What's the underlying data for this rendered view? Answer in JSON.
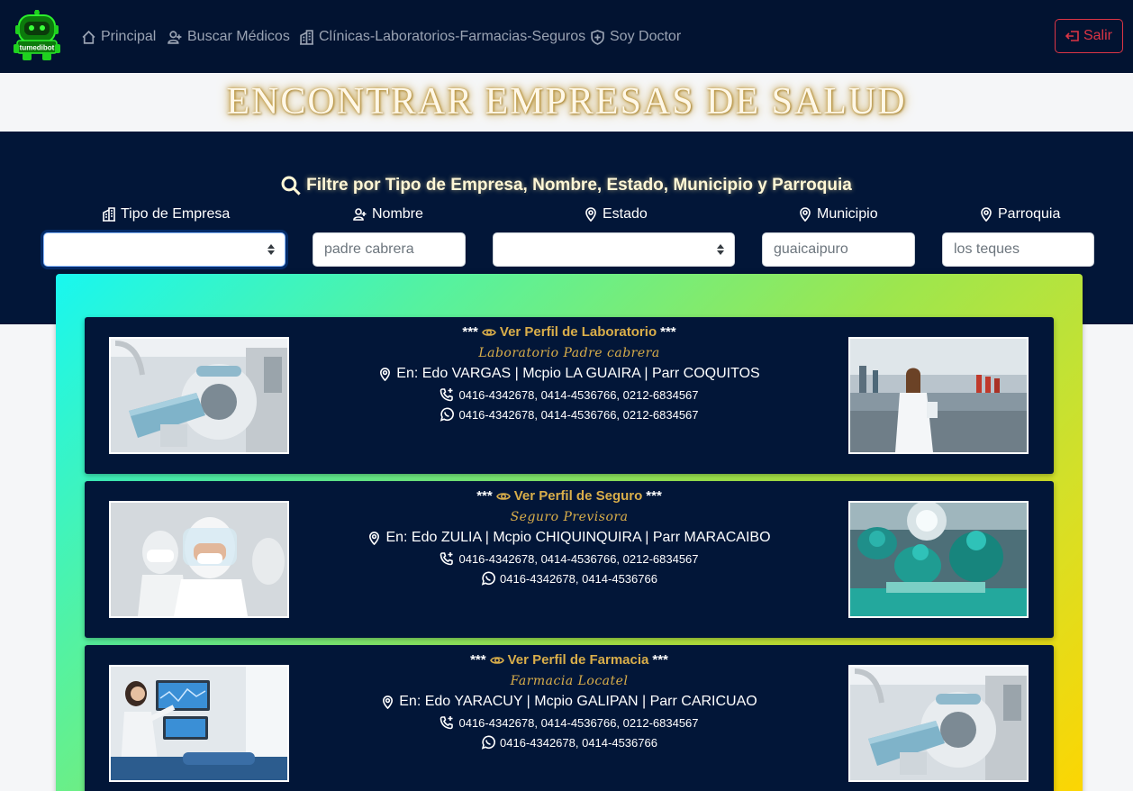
{
  "nav": {
    "logo_text": "tumedibot",
    "items": [
      {
        "label": "Principal",
        "icon": "house-icon"
      },
      {
        "label": "Buscar Médicos",
        "icon": "person-plus-icon"
      },
      {
        "label": "Clínicas-Laboratorios-Farmacias-Seguros",
        "icon": "buildings-icon"
      },
      {
        "label": "Soy Doctor",
        "icon": "shield-plus-icon"
      }
    ],
    "logout_label": "Salir"
  },
  "page_title": "ENCONTRAR EMPRESAS DE SALUD",
  "filters": {
    "heading": "Filtre por Tipo de Empresa, Nombre, Estado, Municipio y Parroquia",
    "tipo": {
      "label": "Tipo de Empresa",
      "value": ""
    },
    "nombre": {
      "label": "Nombre",
      "placeholder": "padre cabrera"
    },
    "estado": {
      "label": "Estado",
      "value": ""
    },
    "municipio": {
      "label": "Municipio",
      "placeholder": "guaicaipuro"
    },
    "parroquia": {
      "label": "Parroquia",
      "placeholder": "los teques"
    }
  },
  "results": [
    {
      "stars_left": "***",
      "perfil_label": "Ver Perfil de Laboratorio",
      "stars_right": "***",
      "name": "Laboratorio Padre cabrera",
      "location": "En: Edo VARGAS | Mcpio LA GUAIRA | Parr COQUITOS",
      "phones": "0416-4342678, 0414-4536766, 0212-6834567",
      "whatsapp": "0416-4342678, 0414-4536766, 0212-6834567"
    },
    {
      "stars_left": "***",
      "perfil_label": "Ver Perfil de Seguro",
      "stars_right": "***",
      "name": "Seguro Previsora",
      "location": "En: Edo ZULIA | Mcpio CHIQUINQUIRA | Parr MARACAIBO",
      "phones": "0416-4342678, 0414-4536766, 0212-6834567",
      "whatsapp": "0416-4342678, 0414-4536766"
    },
    {
      "stars_left": "***",
      "perfil_label": "Ver Perfil de Farmacia",
      "stars_right": "***",
      "name": "Farmacia Locatel",
      "location": "En: Edo YARACUY | Mcpio GALIPAN | Parr CARICUAO",
      "phones": "0416-4342678, 0414-4536766, 0212-6834567",
      "whatsapp": "0416-4342678, 0414-4536766"
    }
  ],
  "colors": {
    "navbar": "#021331",
    "section": "#021638",
    "accent_gold": "#d9ae4a",
    "logout_red": "#dc3545"
  }
}
